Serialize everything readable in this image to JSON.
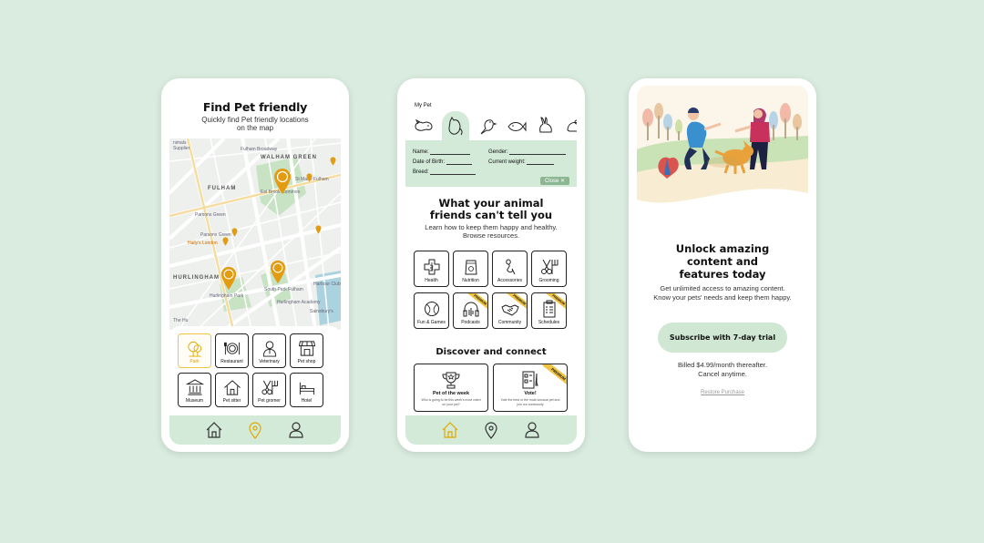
{
  "map_screen": {
    "title": "Find Pet friendly",
    "subtitle": "Quickly find Pet friendly locations on the map",
    "map_labels": {
      "walham_green": "WALHAM GREEN",
      "fulham": "FULHAM",
      "hurlingham": "HURLINGHAM",
      "fulham_broadway": "Fulham Broadway",
      "parsons_green": "Parsons Green",
      "parsons_green_2": "Parsons Green",
      "hallys_london": "Hally's London",
      "harbour_club": "Harbour Club",
      "hurlingham_academy": "Hurlingham Academy",
      "sainsburys": "Sainsbury's",
      "eel_brook": "Eel Brook Common",
      "st_marie": "St Marie Fulham",
      "south_park": "South Park Fulham",
      "hurlingham_park": "Hurlingham Park",
      "the_hurlingham": "The Hu",
      "supplier": "Supplier",
      "nimals": "nimals"
    },
    "categories": [
      {
        "label": "Park",
        "icon": "tree-icon"
      },
      {
        "label": "Restaurant",
        "icon": "plate-icon"
      },
      {
        "label": "Veterinary",
        "icon": "vet-icon"
      },
      {
        "label": "Pet shop",
        "icon": "shop-icon"
      },
      {
        "label": "Museum",
        "icon": "museum-icon"
      },
      {
        "label": "Pet sitter",
        "icon": "house-icon"
      },
      {
        "label": "Pet gromer",
        "icon": "scissors-icon"
      },
      {
        "label": "Hotel",
        "icon": "bed-icon"
      }
    ]
  },
  "resources_screen": {
    "my_pet_label": "My Pet",
    "pets": [
      "dog-icon",
      "cat-icon",
      "bird-icon",
      "fish-icon",
      "rabbit-icon",
      "hamster-icon"
    ],
    "fields": {
      "name": "Name:",
      "gender": "Gender:",
      "dob": "Date of Birth:",
      "weight": "Current weight:",
      "breed": "Breed:"
    },
    "close_label": "Close",
    "heading": "What your animal friends can't tell you",
    "subheading": "Learn how to keep them happy and healthy. Browse resources.",
    "resources": [
      {
        "label": "Health",
        "premium": false
      },
      {
        "label": "Nutrition",
        "premium": false
      },
      {
        "label": "Accessories",
        "premium": false
      },
      {
        "label": "Grooming",
        "premium": false
      },
      {
        "label": "Fun & Games",
        "premium": false
      },
      {
        "label": "Podcasts",
        "premium": true
      },
      {
        "label": "Community",
        "premium": true
      },
      {
        "label": "Schedules",
        "premium": true
      }
    ],
    "premium_label": "PREMIUM",
    "discover_heading": "Discover and connect",
    "pet_of_week": {
      "title": "Pet of the week",
      "desc": "Who is going to be this week's most voted on your pet?"
    },
    "vote": {
      "title": "Vote!",
      "desc": "Vote the best or the most unusual pet and join our community"
    }
  },
  "paywall_screen": {
    "title": "Unlock amazing content and features today",
    "subtitle": "Get unlimited access to amazing content. Know your pets' needs and keep them happy.",
    "subscribe_label": "Subscribe with 7-day trial",
    "billing": "Billed $4.99/month thereafter. Cancel anytime.",
    "restore_label": "Restore Purchase"
  },
  "colors": {
    "background": "#d9ecdf",
    "accent_green": "#d2ead7",
    "accent_yellow": "#f0c545",
    "pin_orange": "#e39b0f"
  }
}
